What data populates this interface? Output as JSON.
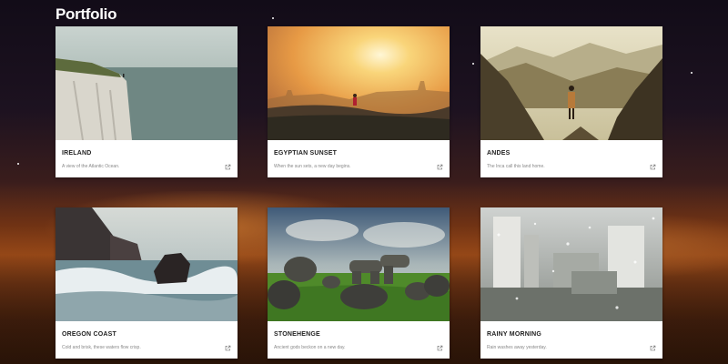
{
  "page": {
    "title": "Portfolio"
  },
  "cards": [
    {
      "title": "IRELAND",
      "description": "A view of the Atlantic Ocean.",
      "link_icon": "external-link-icon"
    },
    {
      "title": "EGYPTIAN SUNSET",
      "description": "When the sun sets, a new day begins.",
      "link_icon": "external-link-icon"
    },
    {
      "title": "ANDES",
      "description": "The Inca call this land home.",
      "link_icon": "external-link-icon"
    },
    {
      "title": "OREGON COAST",
      "description": "Cold and brisk, these waters flow crisp.",
      "link_icon": "external-link-icon"
    },
    {
      "title": "STONEHENGE",
      "description": "Ancient gods beckon on a new day.",
      "link_icon": "external-link-icon"
    },
    {
      "title": "RAINY MORNING",
      "description": "Rain washes away yesterday.",
      "link_icon": "external-link-icon"
    }
  ]
}
